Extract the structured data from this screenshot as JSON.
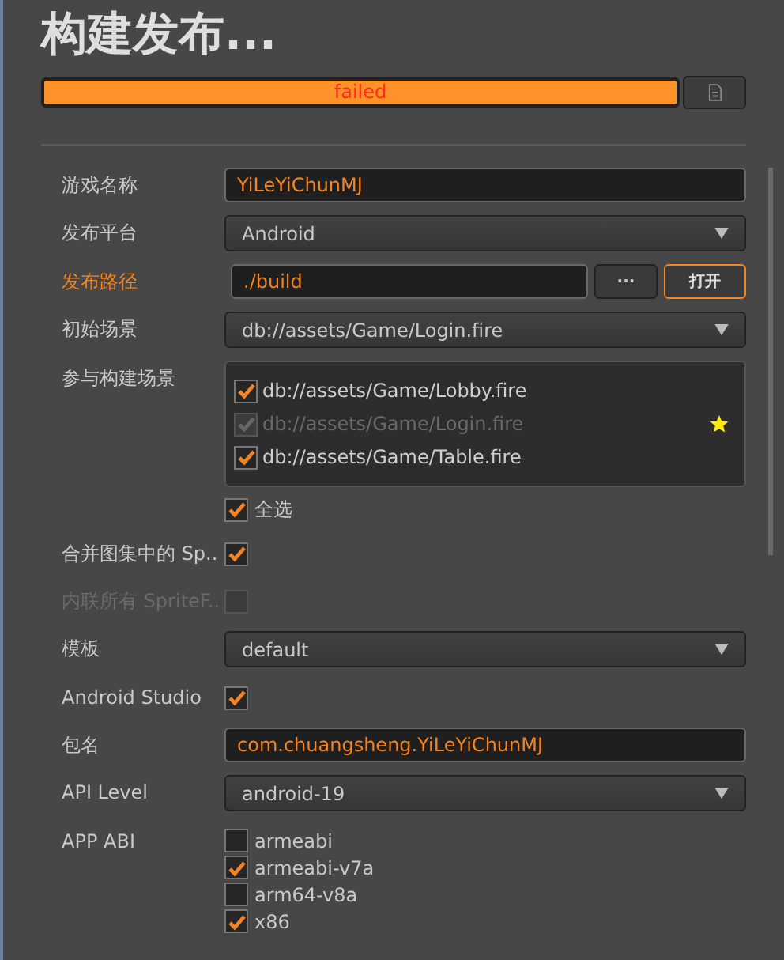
{
  "title": "构建发布...",
  "progress": {
    "level": 1,
    "text": "failed"
  },
  "fields": [
    {
      "kind": "text",
      "label": "游戏名称",
      "value": "YiLeYiChunMJ",
      "highlight": false
    },
    {
      "kind": "select",
      "label": "发布平台",
      "value": "Android",
      "highlight": false
    },
    {
      "kind": "path",
      "label": "发布路径",
      "value": "./build",
      "highlight": true,
      "browse": "···",
      "open": "打开"
    },
    {
      "kind": "select",
      "label": "初始场景",
      "value": "db://assets/Game/Login.fire",
      "highlight": false
    },
    {
      "kind": "scenes",
      "label": "参与构建场景",
      "highlight": false,
      "items": [
        {
          "label": "db://assets/Game/Lobby.fire",
          "checked": true,
          "disabled": false,
          "start_scene": false
        },
        {
          "label": "db://assets/Game/Login.fire",
          "checked": true,
          "disabled": true,
          "start_scene": true
        },
        {
          "label": "db://assets/Game/Table.fire",
          "checked": true,
          "disabled": false,
          "start_scene": false
        }
      ],
      "select_all": {
        "label": "全选",
        "checked": true
      }
    },
    {
      "kind": "checkbox",
      "label": "合并图集中的 Sp..",
      "checked": true,
      "disabled": false,
      "highlight": false
    },
    {
      "kind": "checkbox",
      "label": "内联所有 SpriteF..",
      "checked": false,
      "disabled": true
    },
    {
      "kind": "select",
      "label": "模板",
      "value": "default",
      "highlight": false
    },
    {
      "kind": "checkbox",
      "label": "Android Studio",
      "checked": true,
      "disabled": false,
      "highlight": false
    },
    {
      "kind": "text",
      "label": "包名",
      "value": "com.chuangsheng.YiLeYiChunMJ",
      "highlight": false
    },
    {
      "kind": "select",
      "label": "API Level",
      "value": "android-19",
      "highlight": false
    },
    {
      "kind": "options",
      "label": "APP ABI",
      "highlight": false,
      "items": [
        {
          "label": "armeabi",
          "checked": false
        },
        {
          "label": "armeabi-v7a",
          "checked": true
        },
        {
          "label": "arm64-v8a",
          "checked": false
        },
        {
          "label": "x86",
          "checked": true
        }
      ]
    }
  ]
}
